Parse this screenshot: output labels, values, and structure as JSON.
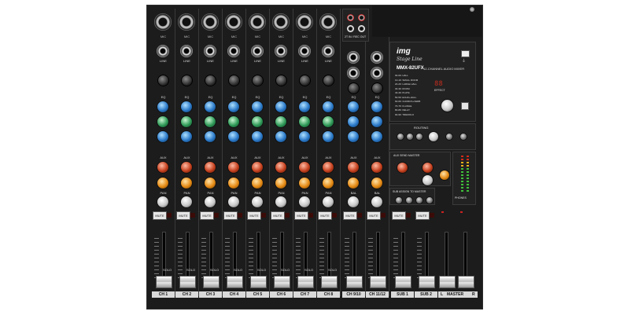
{
  "brand": {
    "logo": "img",
    "sub_brand": "Stage Line",
    "model": "MMX-82UFX",
    "description": "12-CHANNEL AUDIO MIXER"
  },
  "channels": [
    {
      "label": "CH 1"
    },
    {
      "label": "CH 2"
    },
    {
      "label": "CH 3"
    },
    {
      "label": "CH 4"
    },
    {
      "label": "CH 5"
    },
    {
      "label": "CH 6"
    },
    {
      "label": "CH 7"
    },
    {
      "label": "CH 8"
    }
  ],
  "stereo_channels": [
    {
      "label": "CH 9/10",
      "pan": "BAL"
    },
    {
      "label": "CH 11/12",
      "pan": "BAL"
    }
  ],
  "strip": {
    "mic_label": "MIC",
    "line_label": "LINE",
    "eq_label": "EQ",
    "aux_label": "AUX",
    "pan_label": "PAN",
    "mute_label": "MUTE",
    "solo_label": "SOLO"
  },
  "subgroups": [
    {
      "label": "SUB 1"
    },
    {
      "label": "SUB 2"
    }
  ],
  "master": {
    "left": "L",
    "label": "MASTER",
    "right": "R"
  },
  "sections": {
    "rca": "2T IN / REC OUT",
    "effects": "EFFECT",
    "effect_display": "88",
    "routing": "ROUTING",
    "aux_send_master": "AUX SEND MASTER",
    "sub_assign": "SUB ASSIGN TO MASTER",
    "phones": "PHONES"
  },
  "effect_presets": [
    "00-09: HALL",
    "10-19: SMALL ROOM",
    "20-29: LARGE HALL",
    "30-39: ROOM",
    "40-49: PLATE",
    "50-59: ECHO+HALL",
    "60-69: CHORUS+VERB",
    "70-79: FLANGE",
    "80-89: DELAY",
    "90-99: TREMOLO"
  ],
  "colors": {
    "panel": "#1c1c1c",
    "eq_knob": "#2b79c8",
    "mid_knob": "#2f9a58",
    "aux_knob": "#c4401e",
    "fx_knob": "#e58a14",
    "label_strip": "#d9d9d9"
  }
}
